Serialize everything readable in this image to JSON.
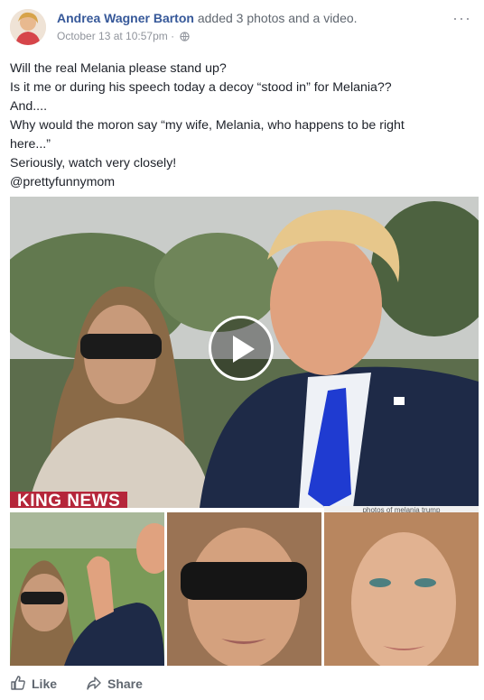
{
  "post": {
    "author": "Andrea Wagner Barton",
    "action": "added 3 photos and a video.",
    "timestamp": "October 13 at 10:57pm",
    "privacy_icon": "globe-icon",
    "more_icon": "ellipsis-icon",
    "more_label": "···",
    "text_lines": [
      "Will the real Melania please stand up?",
      "Is it me or during his speech today a decoy “stood in” for Melania??",
      "And....",
      "Why would the moron say “my wife, Melania, who happens to be right",
      "here...”",
      "Seriously, watch very closely!",
      "@prettyfunnymom"
    ]
  },
  "media": {
    "news_banner": "KING NEWS",
    "search_strip": "photos of melania trump",
    "play_icon": "play-icon"
  },
  "actions": {
    "like_label": "Like",
    "share_label": "Share",
    "like_icon": "thumbs-up-icon",
    "share_icon": "share-arrow-icon"
  },
  "colors": {
    "author_link": "#365899",
    "meta_text": "#90949c",
    "body_text": "#1d2129",
    "banner_red": "#b5263a",
    "tie_blue": "#1f3bd1"
  }
}
